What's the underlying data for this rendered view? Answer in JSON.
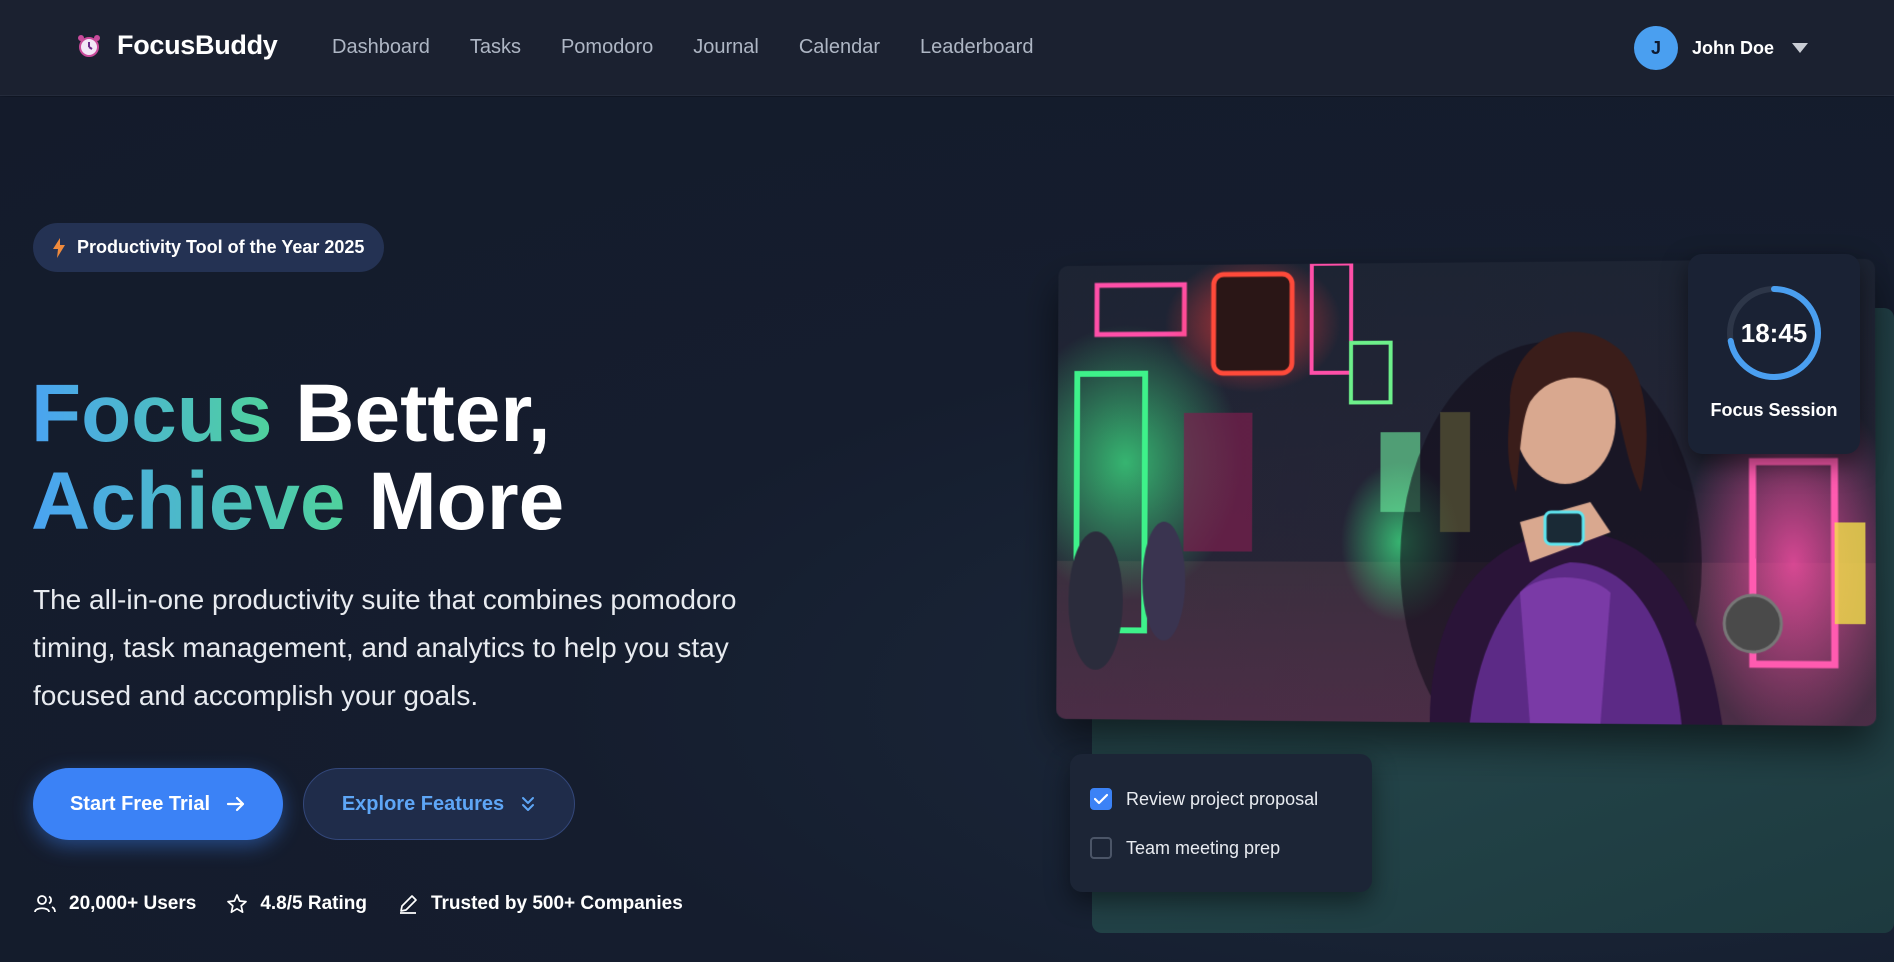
{
  "nav": {
    "brand": "FocusBuddy",
    "links": [
      "Dashboard",
      "Tasks",
      "Pomodoro",
      "Journal",
      "Calendar",
      "Leaderboard"
    ],
    "user": {
      "initial": "J",
      "name": "John Doe"
    }
  },
  "hero": {
    "badge": "Productivity Tool of the Year 2025",
    "headline": {
      "line1_accent": "Focus",
      "line1_rest": "Better,",
      "line2_accent": "Achieve",
      "line2_rest": "More"
    },
    "subtitle": "The all-in-one productivity suite that combines pomodoro timing, task management, and analytics to help you stay focused and accomplish your goals.",
    "primary_button": "Start Free Trial",
    "secondary_button": "Explore Features",
    "stats": [
      "20,000+ Users",
      "4.8/5 Rating",
      "Trusted by 500+ Companies"
    ]
  },
  "timer": {
    "time": "18:45",
    "label": "Focus Session",
    "progress": 0.72
  },
  "tasks": [
    {
      "label": "Review project proposal",
      "checked": true
    },
    {
      "label": "Team meeting prep",
      "checked": false
    }
  ],
  "colors": {
    "accent_blue": "#3b82f6",
    "gradient_start": "#4aa3f2",
    "gradient_end": "#4fd29c",
    "background": "#141c2e"
  }
}
